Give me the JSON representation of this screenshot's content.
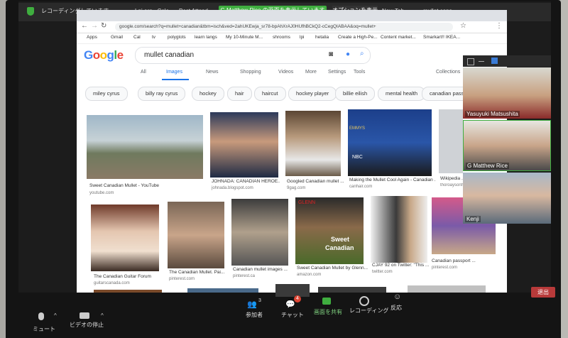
{
  "zoom_top": {
    "tab_recording": "レコーディングしています",
    "tab_lpi": "Lpi.org - Cale",
    "tab_post": "Post Attend",
    "sharing_banner": "G Matthew Rice の画面を表示しています",
    "options_button": "オプションを表示",
    "tab_new": "New Tab",
    "tab_search": "mullet cana"
  },
  "browser": {
    "url": "google.com/search?q=mullet+canadian&tbm=isch&ved=2ahUKEwja_sr78-bpAhXrAJ0HUfhBCkQ2-cCegQIABAA&oq=mullet+",
    "bookmarks": [
      "Apps",
      "Gmail",
      "Cal",
      "tv",
      "polyglots",
      "learn langs",
      "My 10-Minute M...",
      "shrooms",
      "lpi",
      "hetalia",
      "Create a High-Pe...",
      "Content market...",
      "Smarkart!! IKEA..."
    ],
    "logo": "Google",
    "query": "mullet canadian",
    "tabs": [
      "All",
      "Images",
      "News",
      "Shopping",
      "Videos",
      "More",
      "Settings",
      "Tools",
      "Collections"
    ],
    "chips": [
      "miley cyrus",
      "billy ray cyrus",
      "hockey",
      "hair",
      "haircut",
      "hockey player",
      "billie eilish",
      "mental health",
      "canadian passport"
    ],
    "results": [
      {
        "caption": "Sweet Canadian Mullet - YouTube",
        "source": "youtube.com"
      },
      {
        "caption": "JOHNADA: CANADIAN HEROE...",
        "source": "johnada.blogspot.com"
      },
      {
        "caption": "Googled Canadian mullet ...",
        "source": "9gag.com"
      },
      {
        "caption": "Making the Mullet Cool Again - Canadian ...",
        "source": "canhair.com"
      },
      {
        "caption": "Wikipedia ...",
        "source": "thoroaysontv..."
      },
      {
        "caption": "The Canadian Guitar Forum",
        "source": "guitarscanada.com"
      },
      {
        "caption": "The Canadian Mullet. Pai...",
        "source": "pinterest.com"
      },
      {
        "caption": "Canadian mullet images ...",
        "source": "pinterest.ca"
      },
      {
        "caption": "Sweet Canadian Mullet by Glenn...",
        "source": "amazon.com"
      },
      {
        "caption": "CJAY 92 on Twitter: \"This ...",
        "source": "twitter.com"
      },
      {
        "caption": "Canadian passport ...",
        "source": "pinterest.com"
      }
    ],
    "overlay_text": {
      "sweet": "Sweet",
      "canadian": "Canadian",
      "nbc": "NBC",
      "emmys": "EMMYS",
      "glenn": "GLENN"
    }
  },
  "participants": [
    {
      "name": "Yasuyuki Matsushita"
    },
    {
      "name": "G Matthew Rice"
    },
    {
      "name": "Kenji"
    }
  ],
  "controls": {
    "mute": "ミュート",
    "video": "ビデオの停止",
    "participants": "参加者",
    "participants_count": "3",
    "chat": "チャット",
    "chat_badge": "4",
    "share": "画面を共有",
    "record": "レコーディング",
    "react": "反応",
    "end": "退出"
  }
}
